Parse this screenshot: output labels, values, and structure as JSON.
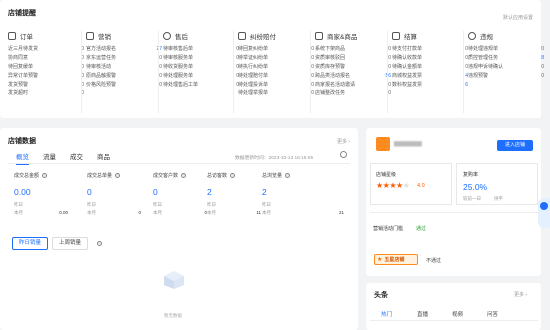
{
  "todo": {
    "title": "店铺提醒",
    "settings_link": "默认应用设置",
    "columns": [
      {
        "title": "订单",
        "rows": [
          {
            "label": "近三月待发货",
            "value": "0"
          },
          {
            "label": "协商同意",
            "value": "0"
          },
          {
            "label": "待回复缓单",
            "value": "0"
          },
          {
            "label": "异常订单预警",
            "value": "0"
          },
          {
            "label": "发货预警",
            "value": "0"
          },
          {
            "label": "发货超时",
            "value": "0"
          }
        ]
      },
      {
        "title": "营销",
        "rows": [
          {
            "label": "官方活动报名",
            "value": "27"
          },
          {
            "label": "京东运营任务",
            "value": "0"
          },
          {
            "label": "待审核活动",
            "value": "0"
          },
          {
            "label": "原商品触报警",
            "value": "0"
          },
          {
            "label": "价格风险预警",
            "value": "0"
          }
        ]
      },
      {
        "title": "售后",
        "rows": [
          {
            "label": "待审核售后单",
            "value": "0"
          },
          {
            "label": "待审核服务单",
            "value": "0"
          },
          {
            "label": "待收货服务单",
            "value": "0"
          },
          {
            "label": "待处理服务单",
            "value": "0"
          },
          {
            "label": "待处理售后工单",
            "value": "0"
          }
        ]
      },
      {
        "title": "纠纷赔付",
        "rows": [
          {
            "label": "待回复纠纷单",
            "value": "0"
          },
          {
            "label": "待举证纠纷单",
            "value": "0"
          },
          {
            "label": "待执行纠纷单",
            "value": "0"
          },
          {
            "label": "待处理赔付单",
            "value": "0"
          },
          {
            "label": "待处理投诉单",
            "value": "0"
          },
          {
            "label": "待处理举报单",
            "value": "0"
          }
        ]
      },
      {
        "title": "商家&商品",
        "rows": [
          {
            "label": "系统下架商品",
            "value": "0"
          },
          {
            "label": "资质审核驳回",
            "value": "0"
          },
          {
            "label": "资质库存预警",
            "value": "0"
          },
          {
            "label": "跨品类活动报名",
            "value": "56"
          },
          {
            "label": "商家报名活动邀请",
            "value": "0"
          },
          {
            "label": "店铺整改任务",
            "value": "0"
          }
        ]
      },
      {
        "title": "结算",
        "rows": [
          {
            "label": "待支付打款单",
            "value": "0"
          },
          {
            "label": "待确认收款单",
            "value": "0"
          },
          {
            "label": "待确认金额单",
            "value": "0"
          },
          {
            "label": "商城权益发票",
            "value": "4"
          },
          {
            "label": "数科权益发票",
            "value": "6"
          }
        ]
      },
      {
        "title": "违规",
        "rows": [
          {
            "label": "待处理违规单",
            "value": "0"
          },
          {
            "label": "质控管理任务",
            "value": "8"
          },
          {
            "label": "违规申诉待确认",
            "value": "0"
          },
          {
            "label": "违规预警",
            "value": "0"
          }
        ]
      }
    ]
  },
  "shop_data": {
    "title": "店铺数据",
    "more": "更多 ›",
    "tabs": [
      "概览",
      "流量",
      "成交",
      "商品"
    ],
    "update_time": "数据更新时间：2023-10-13 16:15:05",
    "metrics": [
      {
        "label": "成交总金额",
        "value": "0.00",
        "yesterday_label": "昨日",
        "yesterday": "",
        "month_label": "本月",
        "month": "0.00"
      },
      {
        "label": "成交总单量",
        "value": "0",
        "yesterday_label": "昨日",
        "yesterday": "",
        "month_label": "本月",
        "month": "0"
      },
      {
        "label": "成交客户数",
        "value": "0",
        "yesterday_label": "昨日",
        "yesterday": "",
        "month_label": "本月",
        "month": "0"
      },
      {
        "label": "总访客数",
        "value": "2",
        "yesterday_label": "昨日",
        "yesterday": "",
        "month_label": "本月",
        "month": "11"
      },
      {
        "label": "总浏览量",
        "value": "2",
        "yesterday_label": "昨日",
        "yesterday": "",
        "month_label": "本月",
        "month": "21"
      }
    ],
    "rank_buttons": [
      "昨日销量",
      "上周销量"
    ],
    "empty_text": "暂无数据"
  },
  "shop_card": {
    "name_blurred": "▆▆▆▆▆▆",
    "enter_button": "进入店铺",
    "rating_label": "店铺星级",
    "rating_value": "4.0",
    "stars": 4,
    "retention_label": "复购率",
    "retention_value": "25.0%",
    "retention_sub": "较前一日",
    "retention_sub2": "持平",
    "activity_label": "营销活动门槛",
    "activity_value": "通过",
    "five_star_label": "五星店铺",
    "five_star_status": "不通过"
  },
  "news": {
    "title": "头条",
    "more": "更多 ›",
    "tabs": [
      "热门",
      "直播",
      "视频",
      "问答"
    ]
  },
  "colors": {
    "accent": "#1e6fff",
    "orange": "#ff6a00",
    "star": "#ff5a00"
  }
}
